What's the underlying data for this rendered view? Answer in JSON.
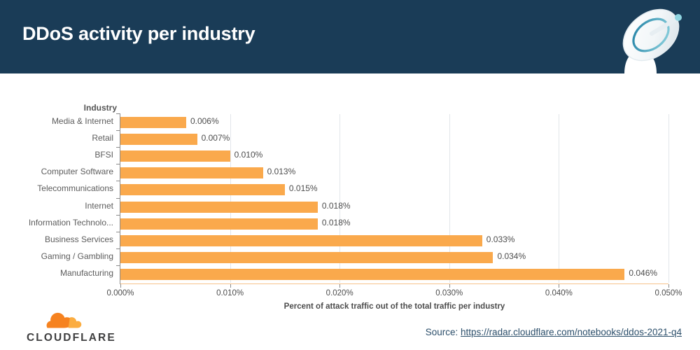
{
  "header": {
    "title": "DDoS activity per industry",
    "background_color": "#1a3c57",
    "icon": "satellite-dish-icon"
  },
  "chart_data": {
    "type": "bar",
    "orientation": "horizontal",
    "title": "DDoS activity per industry",
    "categories": [
      "Media & Internet",
      "Retail",
      "BFSI",
      "Computer Software",
      "Telecommunications",
      "Internet",
      "Information Technolo...",
      "Business Services",
      "Gaming / Gambling",
      "Manufacturing"
    ],
    "values": [
      0.006,
      0.007,
      0.01,
      0.013,
      0.015,
      0.018,
      0.018,
      0.033,
      0.034,
      0.046
    ],
    "value_labels": [
      "0.006%",
      "0.007%",
      "0.010%",
      "0.013%",
      "0.015%",
      "0.018%",
      "0.018%",
      "0.033%",
      "0.034%",
      "0.046%"
    ],
    "ylabel": "Industry",
    "xlabel": "Percent of attack traffic out of the total traffic per industry",
    "xlim": [
      0.0,
      0.05
    ],
    "xticks": [
      0.0,
      0.01,
      0.02,
      0.03,
      0.04,
      0.05
    ],
    "xtick_labels": [
      "0.000%",
      "0.010%",
      "0.020%",
      "0.030%",
      "0.040%",
      "0.050%"
    ],
    "grid": true,
    "legend": false,
    "bar_color": "#faa94c",
    "gridline_color": "#e2e6ea"
  },
  "footer": {
    "logo_text": "CLOUDFLARE",
    "source_prefix": "Source:",
    "source_url": "https://radar.cloudflare.com/notebooks/ddos-2021-q4"
  }
}
